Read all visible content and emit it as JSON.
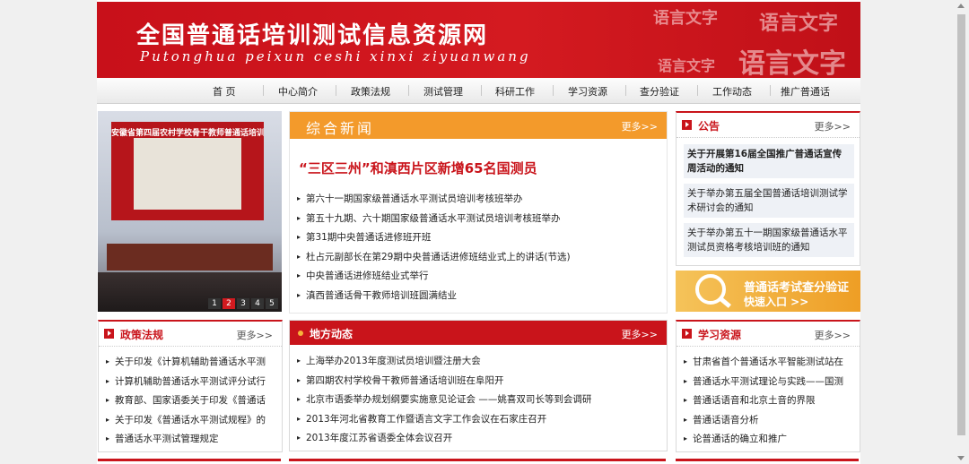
{
  "banner": {
    "title": "全国普通话培训测试信息资源网",
    "pinyin": "Putonghua peixun ceshi xinxi ziyuanwang",
    "calligraphy": [
      "语言文字",
      "语言文字",
      "语言文字",
      "语言文字"
    ]
  },
  "nav": {
    "items": [
      "首 页",
      "中心简介",
      "政策法规",
      "测试管理",
      "科研工作",
      "学习资源",
      "查分验证",
      "工作动态",
      "推广普通话"
    ]
  },
  "slideshow": {
    "banner_text": "安徽省第四届农村学校骨干教师普通话培训班",
    "pages": [
      "1",
      "2",
      "3",
      "4",
      "5"
    ],
    "active_index": 1
  },
  "news": {
    "title": "综合新闻",
    "more": "更多>>",
    "headline": "“三区三州”和滇西片区新增65名国测员",
    "items": [
      "第六十一期国家级普通话水平测试员培训考核班举办",
      "第五十九期、六十期国家级普通话水平测试员培训考核班举办",
      "第31期中央普通话进修班开班",
      "杜占元副部长在第29期中央普通话进修班结业式上的讲话(节选)",
      "中央普通话进修班结业式举行",
      "滇西普通话骨干教师培训班圆满结业"
    ]
  },
  "notice": {
    "title": "公告",
    "more": "更多>>",
    "items": [
      "关于开展第16届全国推广普通话宣传周活动的通知",
      "关于举办第五届全国普通话培训测试学术研讨会的通知",
      "关于举办第五十一期国家级普通话水平测试员资格考核培训班的通知"
    ]
  },
  "quick_entry": {
    "line1": "普通话考试查分验证",
    "line2": "快速入口 >>"
  },
  "policy": {
    "title": "政策法规",
    "more": "更多>>",
    "items": [
      "关于印发《计算机辅助普通话水平测",
      "计算机辅助普通话水平测试评分试行",
      "教育部、国家语委关于印发《普通话",
      "关于印发《普通话水平测试规程》的",
      "普通话水平测试管理规定"
    ]
  },
  "local_news": {
    "title": "地方动态",
    "more": "更多>>",
    "items": [
      "上海举办2013年度测试员培训暨注册大会",
      "第四期农村学校骨干教师普通话培训班在阜阳开",
      "北京市语委举办规划纲要实施意见论证会 ——姚喜双司长等到会调研",
      "2013年河北省教育工作暨语言文字工作会议在石家庄召开",
      "2013年度江苏省语委全体会议召开"
    ]
  },
  "learning": {
    "title": "学习资源",
    "more": "更多>>",
    "items": [
      "甘肃省首个普通话水平智能测试站在",
      "普通话水平测试理论与实践——国测",
      "普通话语音和北京土音的界限",
      "普通话语音分析",
      "论普通话的确立和推广"
    ]
  },
  "colors": {
    "brand_red": "#c9141b",
    "news_orange": "#f39a2b"
  }
}
